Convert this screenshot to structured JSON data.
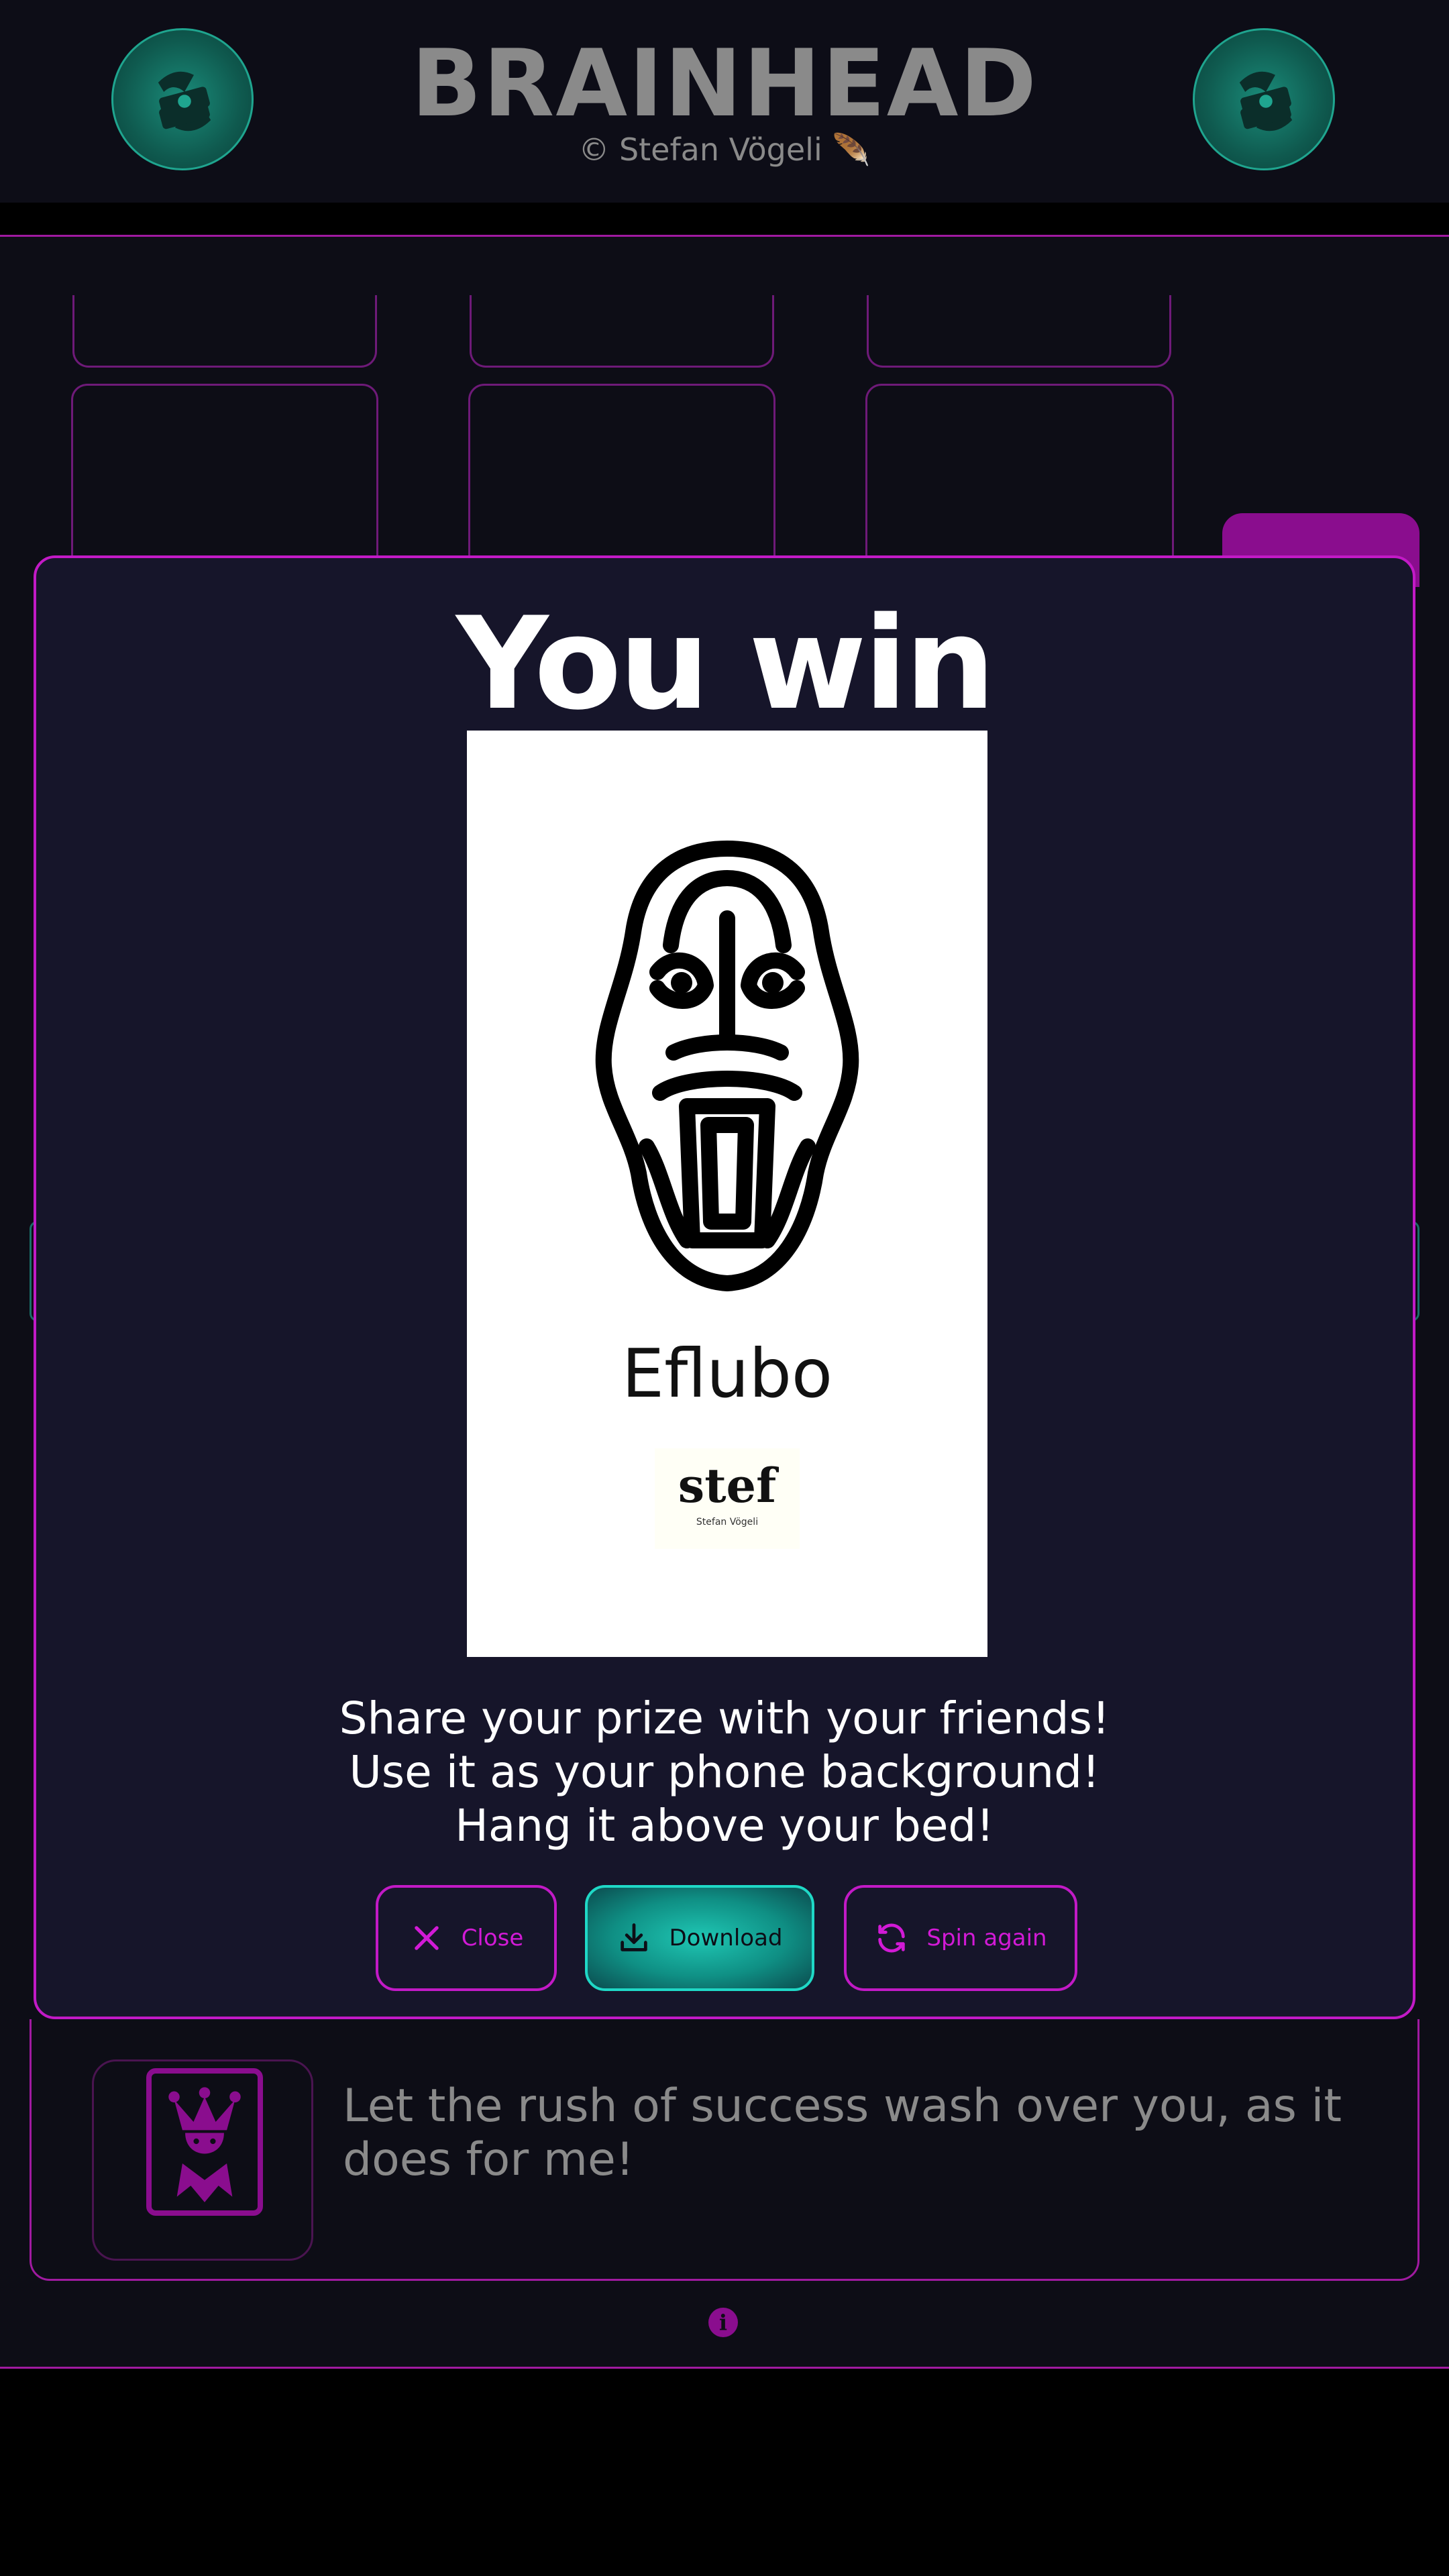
{
  "header": {
    "title": "BRAINHEAD",
    "subtitle": "© Stefan Vögeli 🪶",
    "left_icon": "money-stack-icon",
    "right_icon": "money-stack-icon"
  },
  "modal": {
    "title": "You win",
    "prize_name": "Eflubo",
    "signature": "stef",
    "signature_name": "Stefan Vögeli",
    "messages": [
      "Share your prize with your friends!",
      "Use it as your phone background!",
      "Hang it above your bed!"
    ],
    "buttons": {
      "close": "Close",
      "download": "Download",
      "spin_again": "Spin again"
    }
  },
  "banner": {
    "text": "Let the rush of success wash over you, as it does for me!",
    "icon": "jester-card-icon"
  },
  "info_icon": "info-icon",
  "colors": {
    "accent": "#c21ac6",
    "teal": "#1fc7b4",
    "background": "#0d0d16"
  }
}
